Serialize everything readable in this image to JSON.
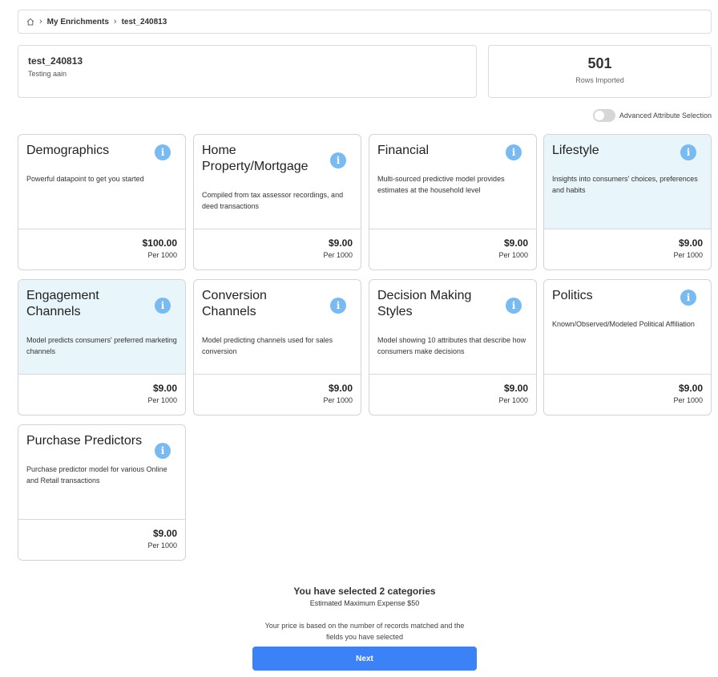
{
  "breadcrumb": {
    "items": [
      "My Enrichments",
      "test_240813"
    ]
  },
  "enrichment": {
    "name": "test_240813",
    "description": "Testing aain"
  },
  "rows": {
    "count": "501",
    "label": "Rows Imported"
  },
  "advanced_toggle": {
    "label": "Advanced Attribute Selection",
    "on": false
  },
  "cards": [
    {
      "title": "Demographics",
      "description": "Powerful datapoint to get you started",
      "price": "$100.00",
      "unit": "Per 1000",
      "selected": false
    },
    {
      "title": "Home Property/Mortgage",
      "description": "Compiled from tax assessor recordings, and deed transactions",
      "price": "$9.00",
      "unit": "Per 1000",
      "selected": false
    },
    {
      "title": "Financial",
      "description": "Multi-sourced predictive model provides estimates at the household level",
      "price": "$9.00",
      "unit": "Per 1000",
      "selected": false
    },
    {
      "title": "Lifestyle",
      "description": "Insights into consumers' choices, preferences and habits",
      "price": "$9.00",
      "unit": "Per 1000",
      "selected": true
    },
    {
      "title": "Engagement Channels",
      "description": "Model predicts consumers' preferred marketing channels",
      "price": "$9.00",
      "unit": "Per 1000",
      "selected": true
    },
    {
      "title": "Conversion Channels",
      "description": "Model predicting channels used for sales conversion",
      "price": "$9.00",
      "unit": "Per 1000",
      "selected": false
    },
    {
      "title": "Decision Making Styles",
      "description": "Model showing 10 attributes that describe how consumers make decisions",
      "price": "$9.00",
      "unit": "Per 1000",
      "selected": false
    },
    {
      "title": "Politics",
      "description": "Known/Observed/Modeled Political Affiliation",
      "price": "$9.00",
      "unit": "Per 1000",
      "selected": false
    },
    {
      "title": "Purchase Predictors",
      "description": "Purchase predictor model for various Online and Retail transactions",
      "price": "$9.00",
      "unit": "Per 1000",
      "selected": false
    }
  ],
  "summary": {
    "selected_text": "You have selected 2 categories",
    "estimate_text": "Estimated Maximum Expense $50",
    "note": "Your price is based on the number of records matched and the fields you have selected"
  },
  "next_button": {
    "label": "Next"
  },
  "colors": {
    "accent": "#3b82f6",
    "selected_bg": "#e8f5fb",
    "info_icon": "#79baf0"
  }
}
